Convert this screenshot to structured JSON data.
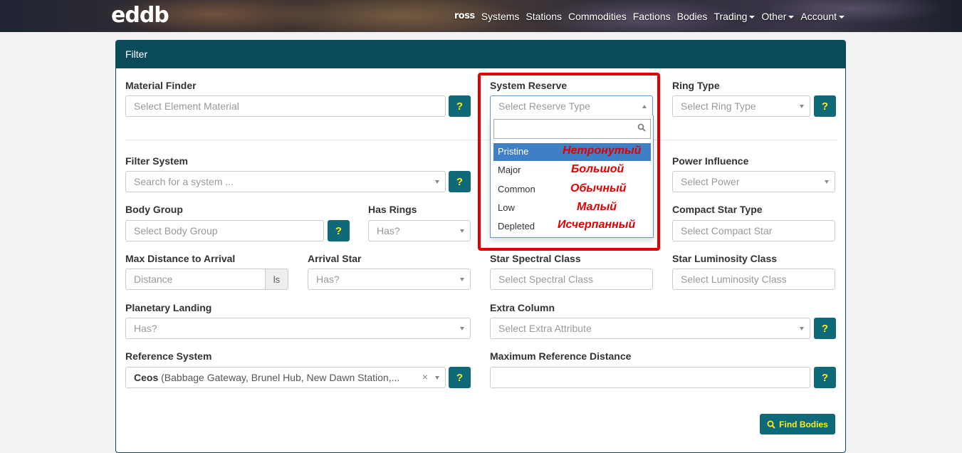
{
  "navbar": {
    "logo": "eddb",
    "items": {
      "ross": "ross",
      "systems": "Systems",
      "stations": "Stations",
      "commodities": "Commodities",
      "factions": "Factions",
      "bodies": "Bodies",
      "trading": "Trading",
      "other": "Other",
      "account": "Account"
    }
  },
  "panel": {
    "title": "Filter"
  },
  "fields": {
    "material_finder": {
      "label": "Material Finder",
      "placeholder": "Select Element Material",
      "help": "?"
    },
    "system_reserve": {
      "label": "System Reserve",
      "placeholder": "Select Reserve Type"
    },
    "ring_type": {
      "label": "Ring Type",
      "placeholder": "Select Ring Type",
      "help": "?"
    },
    "filter_system": {
      "label": "Filter System",
      "placeholder": "Search for a system ...",
      "help": "?"
    },
    "power_influence": {
      "label": "Power Influence",
      "placeholder": "Select Power"
    },
    "body_group": {
      "label": "Body Group",
      "placeholder": "Select Body Group",
      "help": "?"
    },
    "has_rings": {
      "label": "Has Rings",
      "placeholder": "Has?"
    },
    "compact_star_type": {
      "label": "Compact Star Type",
      "placeholder": "Select Compact Star"
    },
    "max_distance": {
      "label": "Max Distance to Arrival",
      "placeholder": "Distance",
      "unit": "ls"
    },
    "arrival_star": {
      "label": "Arrival Star",
      "placeholder": "Has?"
    },
    "star_spectral_class": {
      "label": "Star Spectral Class",
      "placeholder": "Select Spectral Class"
    },
    "star_luminosity_class": {
      "label": "Star Luminosity Class",
      "placeholder": "Select Luminosity Class"
    },
    "planetary_landing": {
      "label": "Planetary Landing",
      "placeholder": "Has?"
    },
    "extra_column": {
      "label": "Extra Column",
      "placeholder": "Select Extra Attribute",
      "help": "?"
    },
    "reference_system": {
      "label": "Reference System",
      "value_name": "Ceos",
      "value_detail": "(Babbage Gateway, Brunel Hub, New Dawn Station,...",
      "clear": "×",
      "help": "?"
    },
    "max_reference_distance": {
      "label": "Maximum Reference Distance",
      "value": "",
      "help": "?"
    }
  },
  "reserve_dropdown": {
    "options": [
      "Pristine",
      "Major",
      "Common",
      "Low",
      "Depleted"
    ],
    "selected": "Pristine",
    "annotations": [
      "Нетронутый",
      "Большой",
      "Обычный",
      "Малый",
      "Исчерпанный"
    ],
    "annotation_color": "#e00000"
  },
  "actions": {
    "find_bodies": "Find Bodies"
  },
  "colors": {
    "panel_header": "#0b4a5b",
    "button": "#0e6978",
    "button_text": "#ffec1a",
    "highlight": "#3f7fc6"
  }
}
